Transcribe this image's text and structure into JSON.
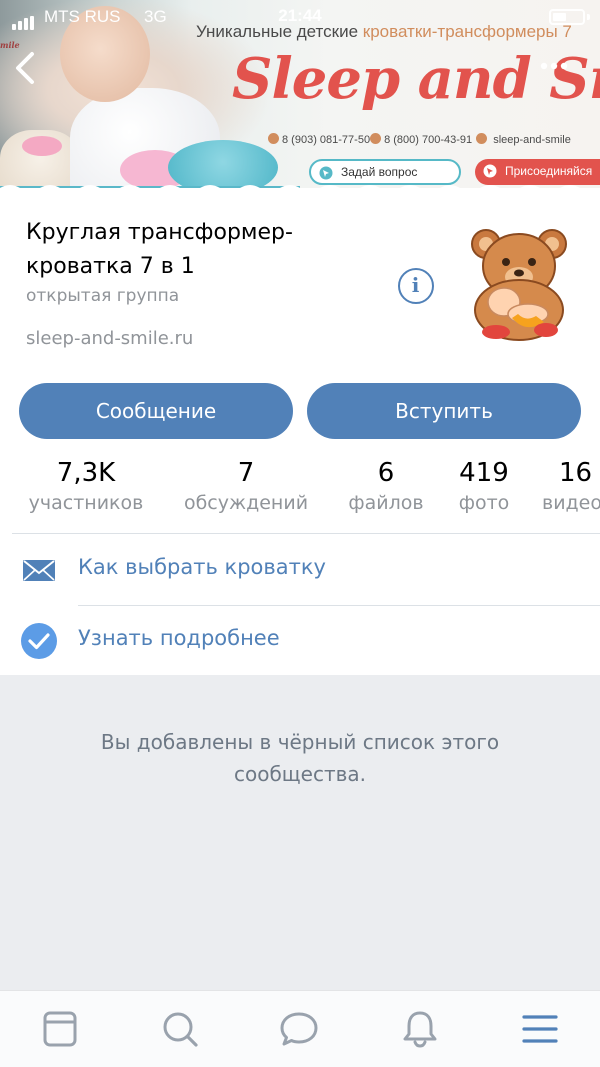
{
  "status_bar": {
    "carrier": "MTS RUS",
    "network": "3G",
    "time": "21:44",
    "battery_level": 0.45
  },
  "cover": {
    "tagline_prefix": "Уникальные детские ",
    "tagline_accent": "кроватки-трансформеры 7",
    "brand": "Sleep and Smile",
    "phone1": "8 (903) 081-77-50",
    "phone2": "8 (800) 700-43-91",
    "site": "sleep-and-smile",
    "ask_button": "Задай вопрос",
    "join_button": "Присоединяйся",
    "corner_logo": "mile",
    "accent_color": "#e2534d",
    "teal_color": "#56b9c7"
  },
  "group": {
    "title": "Круглая трансформер-кроватка 7 в 1",
    "type": "открытая группа",
    "site": "sleep-and-smile.ru",
    "info_icon": "i"
  },
  "actions": {
    "message_label": "Сообщение",
    "join_label": "Вступить"
  },
  "counters": [
    {
      "value": "7,3K",
      "label": "участников"
    },
    {
      "value": "7",
      "label": "обсуждений"
    },
    {
      "value": "6",
      "label": "файлов"
    },
    {
      "value": "419",
      "label": "фото"
    },
    {
      "value": "16",
      "label": "видео"
    }
  ],
  "links": [
    {
      "label": "Как выбрать кроватку",
      "icon": "envelope-icon"
    },
    {
      "label": "Узнать подробнее",
      "icon": "checkmark-circle-icon"
    }
  ],
  "blacklist_message": "Вы добавлены в чёрный список этого сообщества.",
  "tabbar": {
    "tabs": [
      "news-icon",
      "search-icon",
      "messages-icon",
      "notifications-icon",
      "menu-icon"
    ],
    "active_color": "#5181b8",
    "inactive_color": "#99a2ad"
  }
}
